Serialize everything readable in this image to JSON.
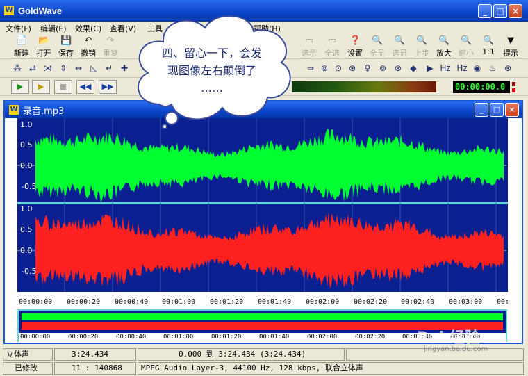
{
  "app": {
    "title": "GoldWave"
  },
  "menu": [
    "文件(F)",
    "编辑(E)",
    "效果(C)",
    "查看(V)",
    "工具"
  ],
  "menu_extra": "帮助(H)",
  "toolbar_main": [
    {
      "label": "新建",
      "icon": "📄"
    },
    {
      "label": "打开",
      "icon": "📂"
    },
    {
      "label": "保存",
      "icon": "💾"
    },
    {
      "label": "撤销",
      "icon": "↶"
    },
    {
      "label": "重复",
      "icon": "↷"
    }
  ],
  "toolbar_right": [
    {
      "label": "选示",
      "icon": "▭"
    },
    {
      "label": "全选",
      "icon": "▭"
    },
    {
      "label": "设置",
      "icon": "❓"
    },
    {
      "label": "全显",
      "icon": "🔍"
    },
    {
      "label": "选显",
      "icon": "🔍"
    },
    {
      "label": "上步",
      "icon": "🔍"
    },
    {
      "label": "放大",
      "icon": "🔍"
    },
    {
      "label": "缩小",
      "icon": "🔍"
    },
    {
      "label": "1:1",
      "icon": "🔍"
    },
    {
      "label": "提示",
      "icon": "▼"
    }
  ],
  "timer": "00:00:00.0",
  "document": {
    "title": "录音.mp3"
  },
  "waveform": {
    "channel1_labels": [
      "1.0",
      "0.5",
      "0.0",
      "-0.5"
    ],
    "channel2_labels": [
      "1.0",
      "0.5",
      "0.0",
      "-0.5"
    ],
    "colors": {
      "left": "#00ff30",
      "right": "#ff2020",
      "background": "#0a2090"
    }
  },
  "timeline": [
    "00:00:00",
    "00:00:20",
    "00:00:40",
    "00:01:00",
    "00:01:20",
    "00:01:40",
    "00:02:00",
    "00:02:20",
    "00:02:40",
    "00:03:00",
    "00:"
  ],
  "overview_timeline": [
    "00:00:00",
    "00:00:20",
    "00:00:40",
    "00:01:00",
    "00:01:20",
    "00:01:40",
    "00:02:00",
    "00:02:20",
    "00:02:40",
    "00:03:00"
  ],
  "status": {
    "row1": {
      "mode": "立体声",
      "length": "3:24.434",
      "selection": "0.000 到 3:24.434 (3:24.434)"
    },
    "row2": {
      "state": "已修改",
      "position": "11 : 140868",
      "format": "MPEG Audio Layer-3, 44100 Hz, 128 kbps, 联合立体声"
    }
  },
  "callout": {
    "line1": "四、留心一下，会发",
    "line2": "现图像左右颠倒了",
    "line3": "……"
  },
  "watermark": {
    "brand": "Bai 经验",
    "url": "jingyan.baidu.com"
  }
}
